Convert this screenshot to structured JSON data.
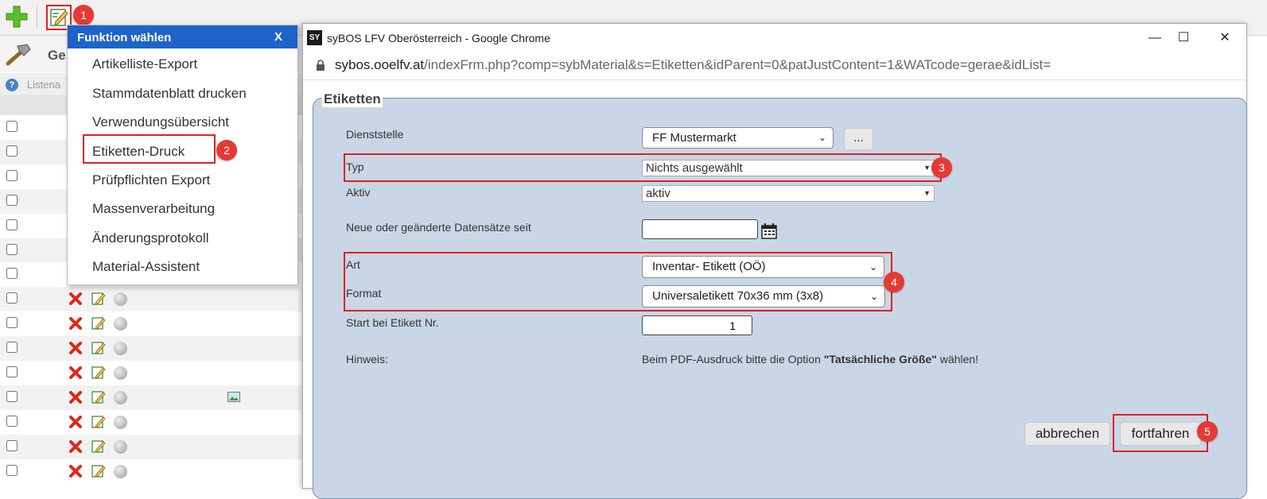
{
  "markers": [
    "1",
    "2",
    "3",
    "4",
    "5"
  ],
  "app": {
    "title": "Ge",
    "liste_label": "Listena",
    "info_icon": "?"
  },
  "menu": {
    "title": "Funktion wählen",
    "close": "X",
    "items": [
      "Artikelliste-Export",
      "Stammdatenblatt drucken",
      "Verwendungsübersicht",
      "Etiketten-Druck",
      "Prüfpflichten Export",
      "Massenverarbeitung",
      "Änderungsprotokoll",
      "Material-Assistent"
    ]
  },
  "window": {
    "icon_text": "SY",
    "title": "syBOS LFV Oberösterreich - Google Chrome",
    "controls": {
      "minimize": "—",
      "maximize": "☐",
      "close": "✕"
    },
    "url_host": "sybos.ooelfv.at",
    "url_path": "/indexFrm.php?comp=sybMaterial&s=Etiketten&idParent=0&patJustContent=1&WATcode=gerae&idList="
  },
  "form": {
    "legend": "Etiketten",
    "dienststelle_label": "Dienststelle",
    "dienststelle_value": "FF Mustermarkt",
    "dienststelle_btn": "...",
    "typ_label": "Typ",
    "typ_value": "Nichts ausgewählt",
    "aktiv_label": "Aktiv",
    "aktiv_value": "aktiv",
    "neu_label": "Neue oder geänderte Datensätze seit",
    "neu_value": "",
    "art_label": "Art",
    "art_value": "Inventar- Etikett (OÖ)",
    "format_label": "Format",
    "format_value": "Universaletikett 70x36 mm (3x8)",
    "start_label": "Start bei Etikett Nr.",
    "start_value": "1",
    "hinweis_label": "Hinweis:",
    "hinweis_pre": "Beim PDF-Ausdruck bitte die Option ",
    "hinweis_bold": "\"Tatsächliche Größe\"",
    "hinweis_post": " wählen!",
    "cancel_label": "abbrechen",
    "continue_label": "fortfahren"
  },
  "icons": [
    "plus-icon",
    "edit-icon",
    "hammer-icon",
    "info-icon",
    "delete-icon",
    "edit-row-icon",
    "status-dot-icon",
    "image-icon",
    "lock-icon",
    "calendar-icon",
    "chevron-down-icon"
  ],
  "colors": {
    "menu_header": "#1d63c9",
    "marker": "#e53935",
    "highlight": "#e02020",
    "fieldset_bg": "#c9d6e6"
  }
}
